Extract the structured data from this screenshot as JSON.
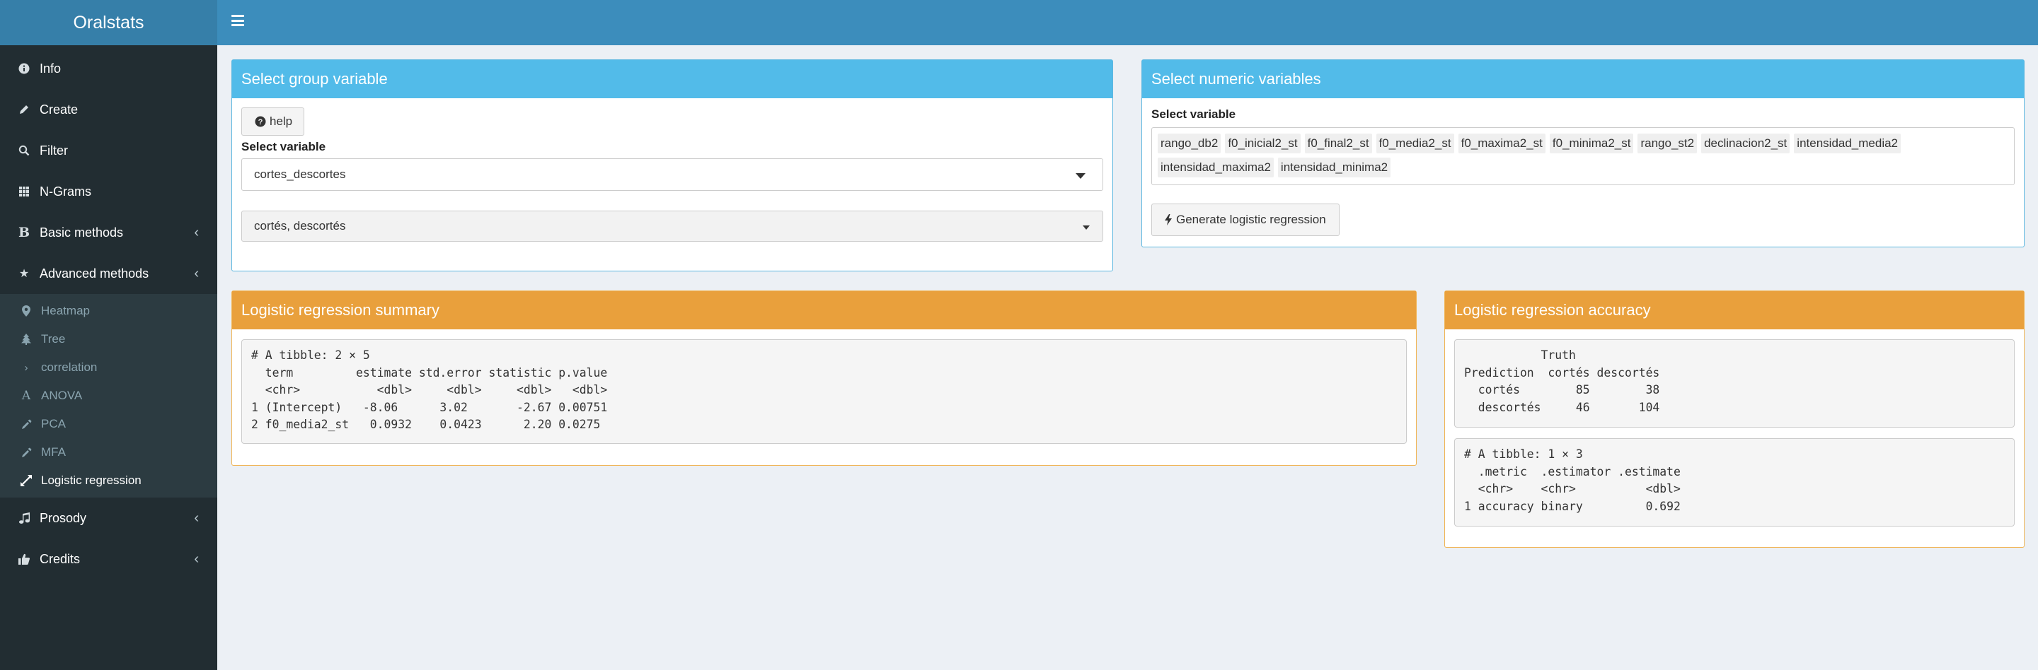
{
  "app": {
    "title": "Oralstats"
  },
  "sidebar": {
    "items": [
      {
        "label": "Info",
        "icon": "info-circle-icon"
      },
      {
        "label": "Create",
        "icon": "pencil-icon"
      },
      {
        "label": "Filter",
        "icon": "search-icon"
      },
      {
        "label": "N-Grams",
        "icon": "grid-icon"
      },
      {
        "label": "Basic methods",
        "icon": "bold-icon"
      },
      {
        "label": "Advanced methods",
        "icon": "star-icon"
      }
    ],
    "advanced_sub": [
      {
        "label": "Heatmap",
        "icon": "map-marker-icon"
      },
      {
        "label": "Tree",
        "icon": "tree-icon"
      },
      {
        "label": "correlation",
        "icon": "chevron-right-icon"
      },
      {
        "label": "ANOVA",
        "icon": "font-a-icon"
      },
      {
        "label": "PCA",
        "icon": "eyedropper-icon"
      },
      {
        "label": "MFA",
        "icon": "eyedropper-icon"
      },
      {
        "label": "Logistic regression",
        "icon": "expand-arrows-icon"
      }
    ],
    "bottom_items": [
      {
        "label": "Prosody",
        "icon": "music-icon"
      },
      {
        "label": "Credits",
        "icon": "thumbs-up-icon"
      }
    ]
  },
  "group_box": {
    "title": "Select group variable",
    "help_label": "help",
    "select_label": "Select variable",
    "select_value": "cortes_descortes",
    "levels_value": "cortés, descortés"
  },
  "numeric_box": {
    "title": "Select numeric variables",
    "select_label": "Select variable",
    "tags": [
      "rango_db2",
      "f0_inicial2_st",
      "f0_final2_st",
      "f0_media2_st",
      "f0_maxima2_st",
      "f0_minima2_st",
      "rango_st2",
      "declinacion2_st",
      "intensidad_media2",
      "intensidad_maxima2",
      "intensidad_minima2"
    ],
    "button_label": "Generate logistic regression"
  },
  "summary_box": {
    "title": "Logistic regression summary",
    "output": "# A tibble: 2 × 5\n  term         estimate std.error statistic p.value\n  <chr>           <dbl>     <dbl>     <dbl>   <dbl>\n1 (Intercept)   -8.06      3.02       -2.67 0.00751\n2 f0_media2_st   0.0932    0.0423      2.20 0.0275 "
  },
  "accuracy_box": {
    "title": "Logistic regression accuracy",
    "confusion": "           Truth\nPrediction  cortés descortés\n  cortés        85        38\n  descortés     46       104",
    "metrics": "# A tibble: 1 × 3\n  .metric  .estimator .estimate\n  <chr>    <chr>          <dbl>\n1 accuracy binary         0.692"
  },
  "colors": {
    "header": "#3c8dbc",
    "logo": "#367fa9",
    "sidebar": "#222d32",
    "box_blue": "#52bbe9",
    "box_orange": "#e9a03c"
  }
}
